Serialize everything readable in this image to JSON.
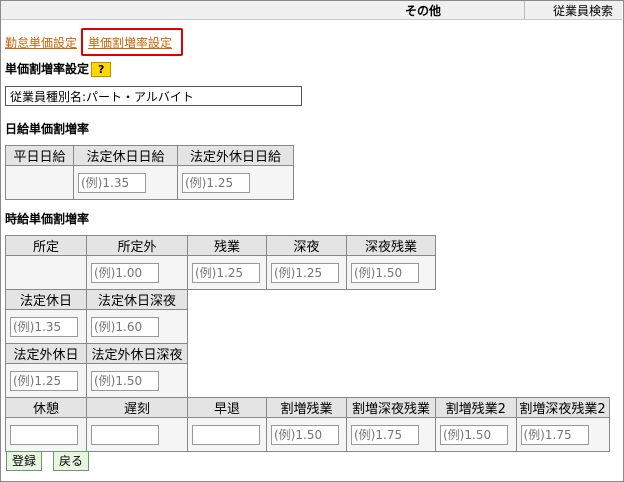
{
  "header": {
    "menu_current": "その他",
    "menu_link": "従業員検索"
  },
  "nav": {
    "link1": "勤怠単価設定",
    "link2": "単価割増率設定"
  },
  "section_title": "単価割増率設定",
  "help_label": "?",
  "employee_type": "従業員種別名:パート・アルバイト",
  "daily": {
    "title": "日給単価割増率",
    "headers": [
      "平日日給",
      "法定休日日給",
      "法定外休日日給"
    ],
    "placeholders": [
      "",
      "(例)1.35",
      "(例)1.25"
    ]
  },
  "hourly": {
    "title": "時給単価割増率",
    "row1_headers": [
      "所定",
      "所定外",
      "残業",
      "深夜",
      "深夜残業"
    ],
    "row1_placeholders": [
      "",
      "(例)1.00",
      "(例)1.25",
      "(例)1.25",
      "(例)1.50"
    ],
    "row2_headers": [
      "法定休日",
      "法定休日深夜"
    ],
    "row2_placeholders": [
      "(例)1.35",
      "(例)1.60"
    ],
    "row3_headers": [
      "法定外休日",
      "法定外休日深夜"
    ],
    "row3_placeholders": [
      "(例)1.25",
      "(例)1.50"
    ],
    "row4_headers": [
      "休憩",
      "遅刻",
      "早退",
      "割増残業",
      "割増深夜残業",
      "割増残業2",
      "割増深夜残業2"
    ],
    "row4_placeholders": [
      "",
      "",
      "",
      "(例)1.50",
      "(例)1.75",
      "(例)1.50",
      "(例)1.75"
    ]
  },
  "buttons": {
    "register": "登録",
    "back": "戻る"
  }
}
